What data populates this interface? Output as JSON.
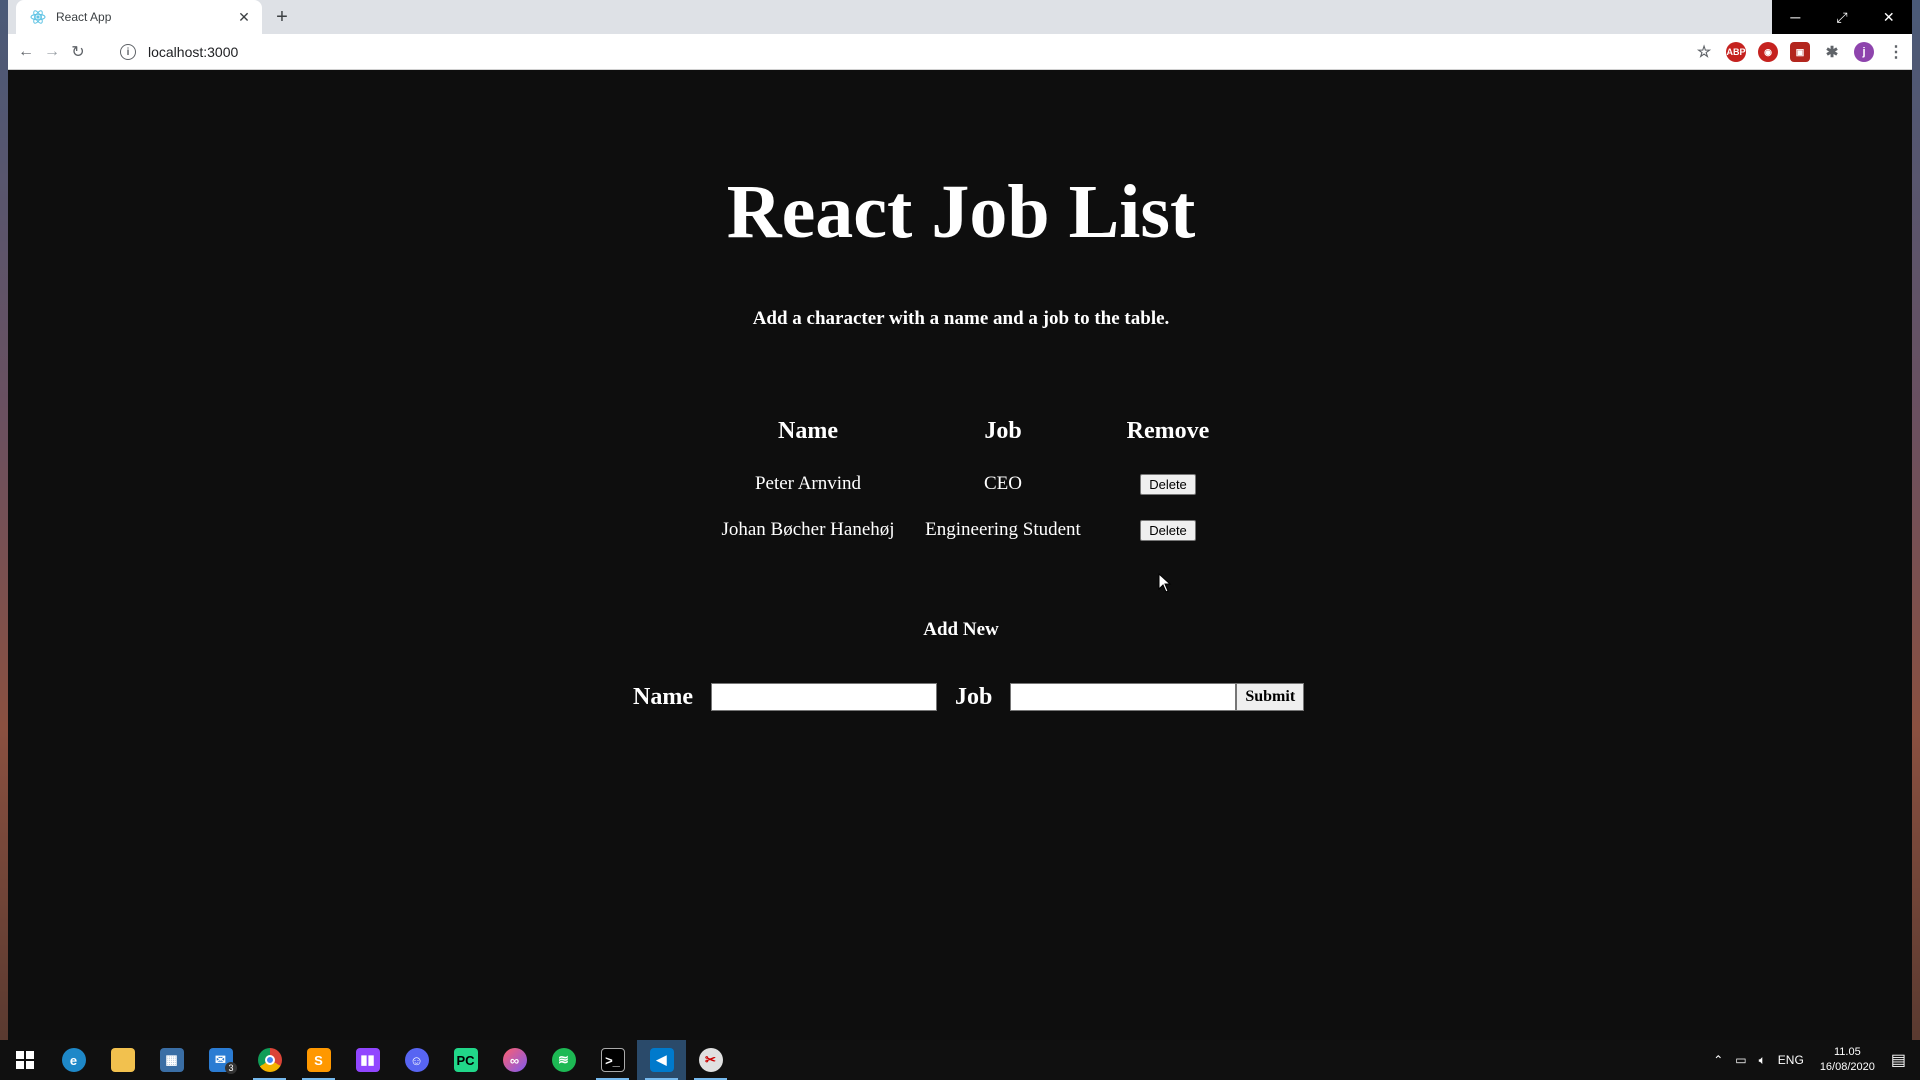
{
  "browser": {
    "tab_title": "React App",
    "url": "localhost:3000",
    "new_tab": "+",
    "close_tab": "✕"
  },
  "page": {
    "title": "React Job List",
    "subtitle": "Add a character with a name and a job to the table.",
    "table": {
      "headers": [
        "Name",
        "Job",
        "Remove"
      ],
      "rows": [
        {
          "name": "Peter Arnvind",
          "job": "CEO",
          "action": "Delete"
        },
        {
          "name": "Johan Bøcher Hanehøj",
          "job": "Engineering Student",
          "action": "Delete"
        }
      ]
    },
    "add_new": "Add New",
    "form": {
      "name_label": "Name",
      "name_value": "",
      "job_label": "Job",
      "job_value": "",
      "submit_label": "Submit"
    }
  },
  "taskbar": {
    "mail_badge": "3",
    "language": "ENG",
    "time": "11.05",
    "date": "16/08/2020"
  }
}
